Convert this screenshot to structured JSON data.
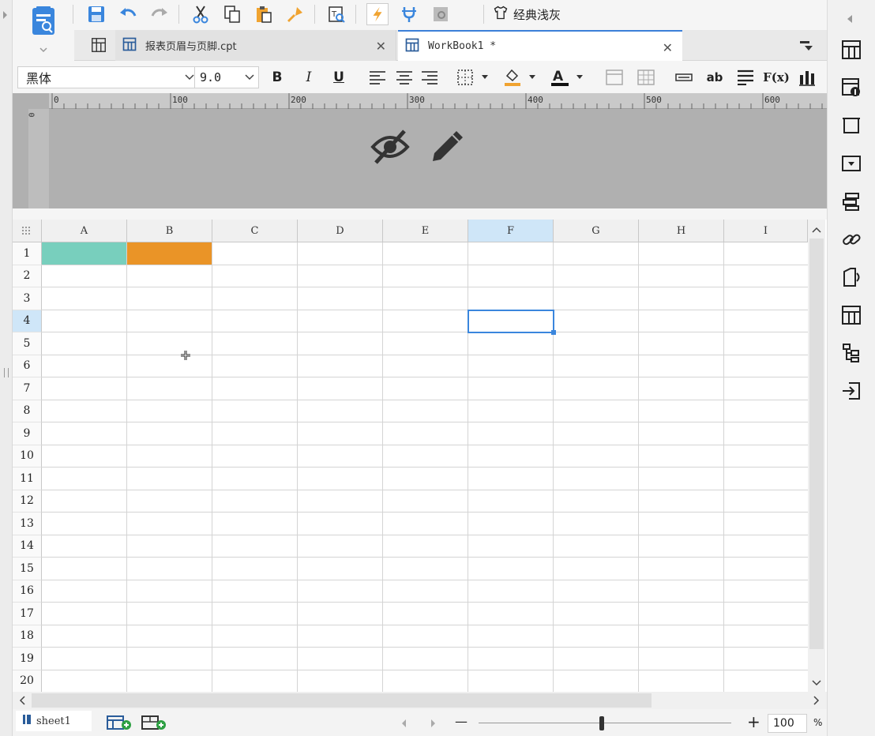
{
  "toolbar": {
    "icons": [
      "save-icon",
      "undo-icon",
      "redo-icon",
      "cut-icon",
      "copy-icon",
      "paste-icon",
      "format-painter-icon",
      "template-preview-icon",
      "flash-icon",
      "plugin-icon",
      "chart-preview-icon"
    ],
    "theme_label": "经典浅灰"
  },
  "tabs": [
    {
      "label": "报表页眉与页脚.cpt",
      "active": false
    },
    {
      "label": "WorkBook1 *",
      "active": true
    }
  ],
  "format": {
    "font_name": "黑体",
    "font_size": "9.0",
    "bold": "B",
    "italic": "I",
    "underline": "U",
    "wrap_label": "ab",
    "formula_label": "F(x)",
    "fill_color": "#f0a330",
    "font_color": "#111111"
  },
  "ruler": {
    "h_labels": [
      "0",
      "100",
      "200",
      "300",
      "400",
      "500",
      "600"
    ],
    "v_label": "0"
  },
  "grid": {
    "columns": [
      "A",
      "B",
      "C",
      "D",
      "E",
      "F",
      "G",
      "H",
      "I"
    ],
    "rows": [
      "1",
      "2",
      "3",
      "4",
      "5",
      "6",
      "7",
      "8",
      "9",
      "10",
      "11",
      "12",
      "13",
      "14",
      "15",
      "16",
      "17",
      "18",
      "19",
      "20"
    ],
    "active_column": "F",
    "active_row": "4",
    "cell_fills": {
      "A1": "#78cfbd",
      "B1": "#ea9427"
    }
  },
  "status": {
    "sheet_name": "sheet1",
    "zoom_minus": "—",
    "zoom_plus": "+",
    "zoom_value": "100",
    "zoom_unit": "%"
  },
  "colors": {
    "accent": "#3a86dd",
    "selection": "#cfe6f8"
  }
}
